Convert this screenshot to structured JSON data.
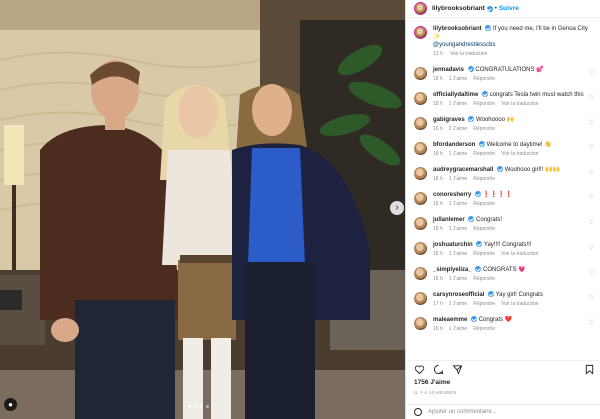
{
  "post": {
    "username": "lilybrooksobriant",
    "follow_label": "Suivre",
    "caption_text": "If you need me, I'll be in Genoa City",
    "caption_mention": "@youngandrestlesscbs",
    "caption_time": "13 h",
    "caption_translate": "Voir la traduction",
    "likes": "1756 J'aime",
    "date": "IL Y A 13 HEURES",
    "add_comment_placeholder": "Ajouter un commentaire..."
  },
  "comments": [
    {
      "user": "jennadavis",
      "text": "CONGRATULATIONS",
      "emoji": "💕",
      "time": "18 h",
      "likes": "1 J'aime",
      "reply": "Répondre",
      "translate": ""
    },
    {
      "user": "officiallydaltime",
      "text": "congrats Tesla twin must watch this",
      "emoji": "",
      "time": "18 h",
      "likes": "1 J'aime",
      "reply": "Répondre",
      "translate": "Voir la traduction"
    },
    {
      "user": "gabigraves",
      "text": "Woohoooo",
      "emoji": "🙌",
      "time": "16 h",
      "likes": "2 J'aime",
      "reply": "Répondre",
      "translate": ""
    },
    {
      "user": "bfordanderson",
      "text": "Welcome to daytime!",
      "emoji": "👋",
      "time": "18 h",
      "likes": "1 J'aime",
      "reply": "Répondre",
      "translate": "Voir la traduction"
    },
    {
      "user": "audreygracemarshall",
      "text": "Woohooo girl!!",
      "emoji": "🙌🙌",
      "time": "18 h",
      "likes": "1 J'aime",
      "reply": "Répondre",
      "translate": ""
    },
    {
      "user": "conoresherry",
      "text": "",
      "emoji": "❗❗❗❗",
      "time": "18 h",
      "likes": "1 J'aime",
      "reply": "Répondre",
      "translate": ""
    },
    {
      "user": "jullanlemer",
      "text": "Congrats!",
      "emoji": "",
      "time": "18 h",
      "likes": "1 J'aime",
      "reply": "Répondre",
      "translate": ""
    },
    {
      "user": "joshuaturchin",
      "text": "Yay!!!! Congrats!!!",
      "emoji": "",
      "time": "18 h",
      "likes": "1 J'aime",
      "reply": "Répondre",
      "translate": "Voir la traduction"
    },
    {
      "user": "_simplyeliza_",
      "text": "CONGRATS",
      "emoji": "💗",
      "time": "18 h",
      "likes": "1 J'aime",
      "reply": "Répondre",
      "translate": ""
    },
    {
      "user": "carsynroseofficial",
      "text": "Yay girl! Congrats",
      "emoji": "",
      "time": "17 h",
      "likes": "1 J'aime",
      "reply": "Répondre",
      "translate": "Voir la traduction"
    },
    {
      "user": "maleaemme",
      "text": "Congrats",
      "emoji": "❤️",
      "time": "16 h",
      "likes": "1 J'aime",
      "reply": "Répondre",
      "translate": ""
    }
  ],
  "icons": {
    "like": "heart-icon",
    "comment": "comment-icon",
    "share": "paper-plane-icon",
    "save": "bookmark-icon",
    "tag": "user-tag-icon",
    "next": "chevron-right-icon"
  },
  "colors": {
    "accent": "#0095f6",
    "verified": "#3897f0",
    "meta": "#8e8e8e"
  }
}
